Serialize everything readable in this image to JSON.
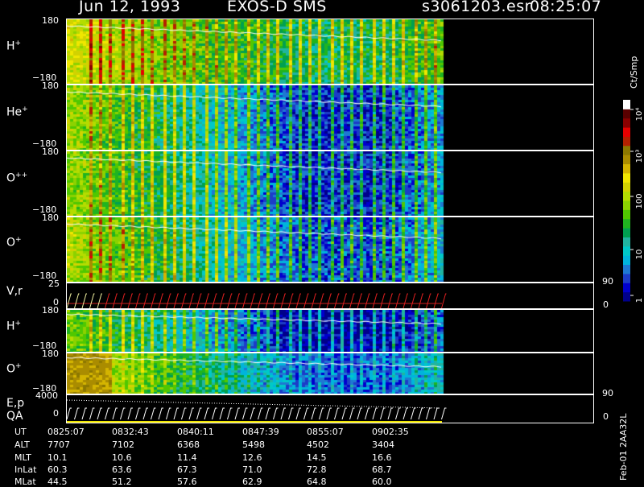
{
  "header": {
    "date": "Jun 12, 1993",
    "instrument": "EXOS-D SMS",
    "file": "s3061203.esr",
    "time": "08:25:07"
  },
  "panels": [
    {
      "label": "H",
      "sup": "+",
      "ytop": "180",
      "ybot": "−180",
      "icon": "spectrogram"
    },
    {
      "label": "He",
      "sup": "+",
      "ytop": "180",
      "ybot": "−180",
      "icon": "spectrogram"
    },
    {
      "label": "O",
      "sup": "++",
      "ytop": "180",
      "ybot": "−180",
      "icon": "spectrogram"
    },
    {
      "label": "O",
      "sup": "+",
      "ytop": "180",
      "ybot": "−180",
      "icon": "spectrogram"
    },
    {
      "label": "V,r",
      "sup": "",
      "ytop": "25",
      "ybot": "0",
      "rtop": "90",
      "rbot": "0",
      "icon": "line-plot"
    },
    {
      "label": "H",
      "sup": "+",
      "ytop": "180",
      "ybot": "−180",
      "icon": "spectrogram"
    },
    {
      "label": "O",
      "sup": "+",
      "ytop": "180",
      "ybot": "−180",
      "icon": "spectrogram"
    },
    {
      "label": "E,p",
      "label2": "QA",
      "sup": "",
      "ytop": "4000",
      "ybot": "0",
      "rtop": "90",
      "rbot": "0",
      "icon": "line-plot"
    }
  ],
  "colorbar": {
    "units": "Ct/Smp",
    "labels": [
      "1",
      "10",
      "100",
      "10³",
      "10⁴"
    ],
    "colors": [
      "#00008b",
      "#0000cd",
      "#1c3cc8",
      "#1e78d2",
      "#00b4dc",
      "#00c8c8",
      "#20b4a0",
      "#00a050",
      "#20b420",
      "#50c800",
      "#8cd200",
      "#b4dc00",
      "#d2d200",
      "#f0e600",
      "#d4b400",
      "#aa8c00",
      "#8c7800",
      "#b42000",
      "#e60000",
      "#8b0000",
      "#5a0000",
      "#ffffff"
    ],
    "icon": "color-scale"
  },
  "orbit_table": {
    "rows": [
      {
        "label": "UT",
        "values": [
          "0825:07",
          "0832:43",
          "0840:11",
          "0847:39",
          "0855:07",
          "0902:35"
        ]
      },
      {
        "label": "ALT",
        "values": [
          "7707",
          "7102",
          "6368",
          "5498",
          "4502",
          "3404"
        ]
      },
      {
        "label": "MLT",
        "values": [
          "10.1",
          "10.6",
          "11.4",
          "12.6",
          "14.5",
          "16.6"
        ]
      },
      {
        "label": "InLat",
        "values": [
          "60.3",
          "63.6",
          "67.3",
          "71.0",
          "72.8",
          "68.7"
        ]
      },
      {
        "label": "MLat",
        "values": [
          "44.5",
          "51.2",
          "57.6",
          "62.9",
          "64.8",
          "60.0"
        ]
      }
    ]
  },
  "footer_code": "Feb-01 2AA32L",
  "chart_data": {
    "type": "heatmap",
    "title": "Jun 12, 1993   EXOS-D SMS",
    "x": [
      "0825:07",
      "0832:43",
      "0840:11",
      "0847:39",
      "0855:07",
      "0902:35"
    ],
    "ylim": [
      -180,
      180
    ],
    "colorbar_units": "Ct/Smp",
    "colorbar_ticks": [
      "1",
      "10",
      "100",
      "10³",
      "10⁴"
    ],
    "series": [
      {
        "name": "H+",
        "ylim": [
          -180,
          180
        ]
      },
      {
        "name": "He+",
        "ylim": [
          -180,
          180
        ]
      },
      {
        "name": "O++",
        "ylim": [
          -180,
          180
        ]
      },
      {
        "name": "O+",
        "ylim": [
          -180,
          180
        ]
      },
      {
        "name": "V,r",
        "ylim": [
          0,
          25
        ],
        "right_ylim": [
          0,
          90
        ]
      },
      {
        "name": "H+",
        "ylim": [
          -180,
          180
        ]
      },
      {
        "name": "O+",
        "ylim": [
          -180,
          180
        ]
      },
      {
        "name": "E,p",
        "ylim": [
          0,
          4000
        ],
        "right_ylim": [
          0,
          90
        ]
      }
    ]
  }
}
